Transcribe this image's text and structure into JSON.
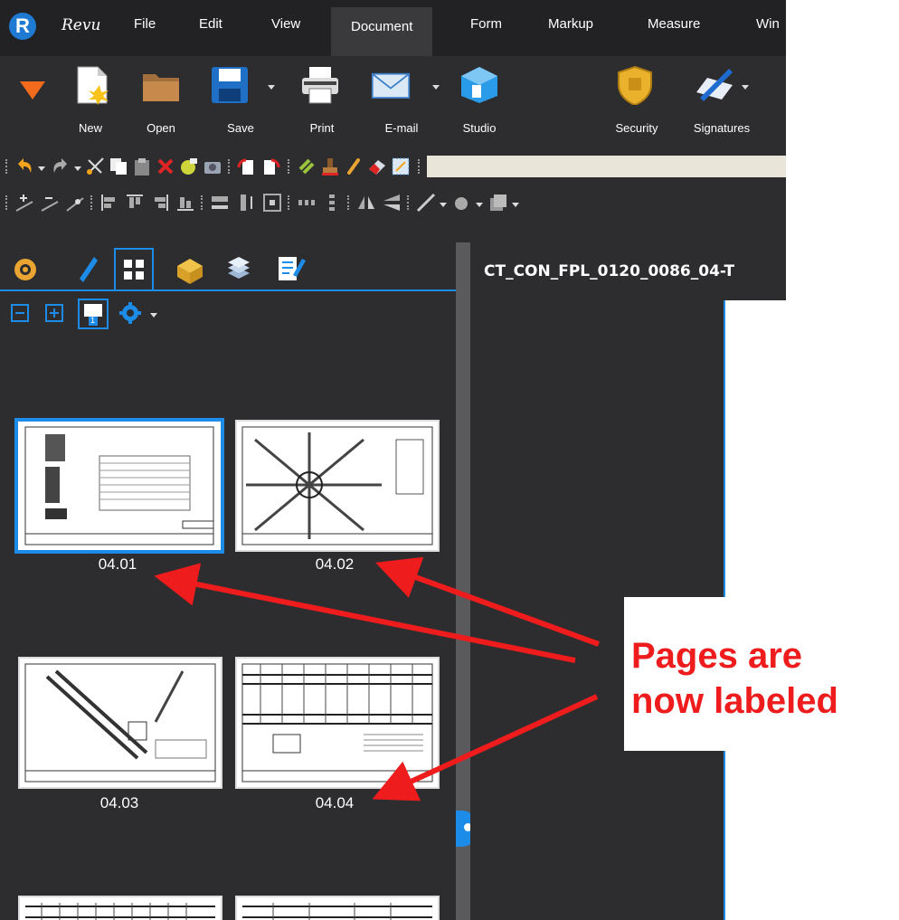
{
  "app": {
    "logo_letter": "R",
    "logo_text": "Revu"
  },
  "menu": [
    "File",
    "Edit",
    "View",
    "Document",
    "Form",
    "Markup",
    "Measure",
    "Win"
  ],
  "menu_active_index": 3,
  "ribbon": {
    "buttons": [
      {
        "label": "New",
        "icon": "new-document-icon"
      },
      {
        "label": "Open",
        "icon": "folder-icon"
      },
      {
        "label": "Save",
        "icon": "floppy-disk-icon"
      },
      {
        "label": "Print",
        "icon": "printer-icon"
      },
      {
        "label": "E-mail",
        "icon": "envelope-icon"
      },
      {
        "label": "Studio",
        "icon": "studio-cube-icon"
      },
      {
        "label": "Security",
        "icon": "shield-icon"
      },
      {
        "label": "Signatures",
        "icon": "pen-signature-icon"
      }
    ]
  },
  "panel": {
    "tabs": [
      "markups-icon",
      "bookmarks-icon",
      "thumbnails-icon",
      "file-access-icon",
      "layers-icon",
      "properties-icon"
    ],
    "active_tab_index": 2,
    "tools": [
      "collapse-icon",
      "expand-icon",
      "page-label-icon",
      "settings-gear-icon"
    ],
    "page_label_tool_badge": "1",
    "thumbnails": [
      {
        "label": "04.01",
        "selected": true
      },
      {
        "label": "04.02",
        "selected": false
      },
      {
        "label": "04.03",
        "selected": false
      },
      {
        "label": "04.04",
        "selected": false
      }
    ]
  },
  "document": {
    "title": "CT_CON_FPL_0120_0086_04-T"
  },
  "annotation": {
    "text": "Pages are\nnow labeled",
    "color": "#ee1c1c"
  },
  "colors": {
    "accent": "#1c8ce8",
    "background": "#2d2d30",
    "menubar": "#222225"
  }
}
